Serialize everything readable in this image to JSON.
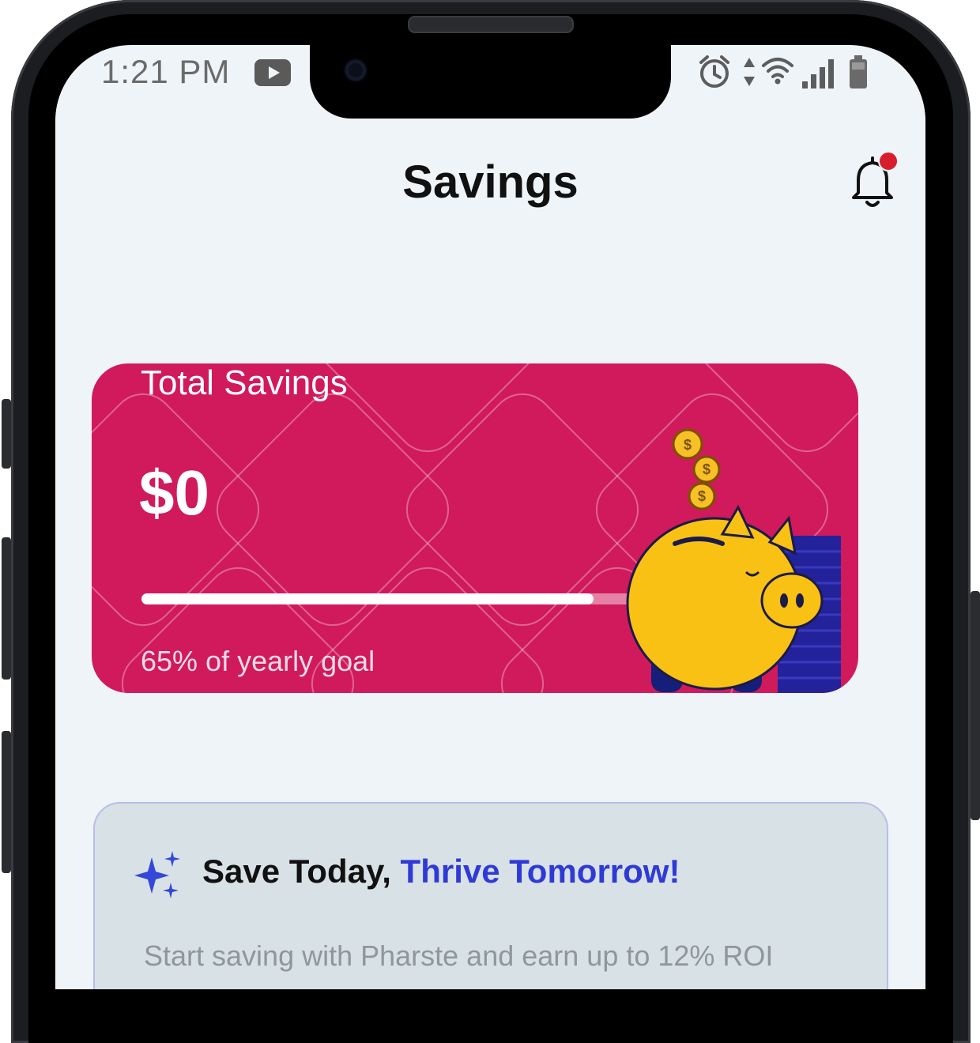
{
  "status_bar": {
    "time": "1:21 PM",
    "icons": [
      "youtube-icon",
      "alarm-icon",
      "data-arrows-icon",
      "wifi-icon",
      "signal-icon",
      "battery-icon"
    ]
  },
  "header": {
    "title": "Savings",
    "notification_icon": "bell-icon",
    "has_unread": true
  },
  "savings_card": {
    "title": "Total Savings",
    "amount": "$0",
    "progress_fraction": 0.65,
    "goal_text": "65% of yearly goal",
    "card_color": "#d01a5b"
  },
  "promo": {
    "icon": "sparkle-icon",
    "title_part1": "Save Today, ",
    "title_part2": "Thrive Tomorrow!",
    "accent_color": "#2f3ad6",
    "body": "Start saving with Pharste and earn up to 12% ROI"
  }
}
